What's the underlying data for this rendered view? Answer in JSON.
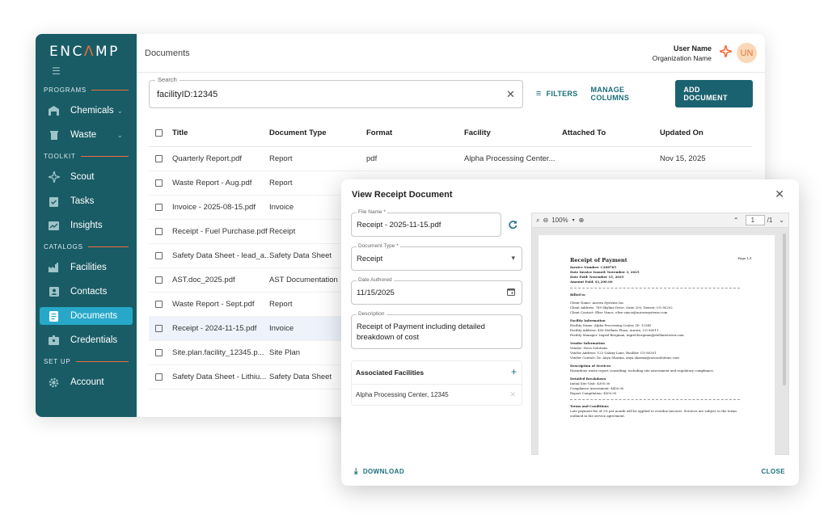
{
  "app": {
    "logo": "ENC",
    "logo_caret": "Λ",
    "logo_rest": "MP",
    "breadcrumb": "Documents",
    "user": {
      "name": "User Name",
      "org": "Organization Name",
      "initials": "UN"
    }
  },
  "sidebar": {
    "sections": {
      "programs": "PROGRAMS",
      "toolkit": "TOOLKIT",
      "catalogs": "CATALOGS",
      "setup": "SET UP"
    },
    "items": {
      "chemicals": "Chemicals",
      "waste": "Waste",
      "scout": "Scout",
      "tasks": "Tasks",
      "insights": "Insights",
      "facilities": "Facilities",
      "contacts": "Contacts",
      "documents": "Documents",
      "credentials": "Credentials",
      "account": "Account"
    },
    "active": "documents"
  },
  "toolbar": {
    "search_label": "Search",
    "search_value": "facilityID:12345",
    "filters": "FILTERS",
    "manage_columns": "MANAGE COLUMNS",
    "add_document": "ADD DOCUMENT"
  },
  "table": {
    "headers": {
      "title": "Title",
      "type": "Document Type",
      "format": "Format",
      "facility": "Facility",
      "attached": "Attached To",
      "updated": "Updated On"
    },
    "rows": [
      {
        "title": "Quarterly Report.pdf",
        "type": "Report",
        "format": "pdf",
        "facility": "Alpha Processing Center...",
        "attached": "",
        "updated": "Nov 15, 2025"
      },
      {
        "title": "Waste Report - Aug.pdf",
        "type": "Report",
        "format": "",
        "facility": "",
        "attached": "",
        "updated": ""
      },
      {
        "title": "Invoice - 2025-08-15.pdf",
        "type": "Invoice",
        "format": "",
        "facility": "",
        "attached": "",
        "updated": ""
      },
      {
        "title": "Receipt - Fuel Purchase.pdf",
        "type": "Receipt",
        "format": "",
        "facility": "",
        "attached": "",
        "updated": ""
      },
      {
        "title": "Safety Data Sheet - lead_a...",
        "type": "Safety Data Sheet",
        "format": "",
        "facility": "",
        "attached": "",
        "updated": ""
      },
      {
        "title": "AST.doc_2025.pdf",
        "type": "AST Documentation",
        "format": "",
        "facility": "",
        "attached": "",
        "updated": ""
      },
      {
        "title": "Waste Report - Sept.pdf",
        "type": "Report",
        "format": "",
        "facility": "",
        "attached": "",
        "updated": ""
      },
      {
        "title": "Receipt - 2024-11-15.pdf",
        "type": "Invoice",
        "format": "",
        "facility": "",
        "attached": "",
        "updated": ""
      },
      {
        "title": "Site.plan.facility_12345.p...",
        "type": "Site Plan",
        "format": "",
        "facility": "",
        "attached": "",
        "updated": ""
      },
      {
        "title": "Safety Data Sheet - Lithiu...",
        "type": "Safety Data Sheet",
        "format": "",
        "facility": "",
        "attached": "",
        "updated": ""
      }
    ]
  },
  "modal": {
    "title": "View Receipt Document",
    "file_name_label": "File Name *",
    "file_name": "Receipt - 2025-11-15.pdf",
    "doc_type_label": "Document Type *",
    "doc_type": "Receipt",
    "date_label": "Date Authored",
    "date": "11/15/2025",
    "desc_label": "Description",
    "desc_line1": "Receipt of Payment including detailed",
    "desc_line2": "breakdown of cost",
    "assoc_header": "Associated Facilities",
    "assoc_item": "Alpha Processing Center, 12345",
    "download": "DOWNLOAD",
    "close": "CLOSE"
  },
  "viewer": {
    "zoom": "100%",
    "page_input": "1",
    "page_total": "/1",
    "doc": {
      "page_label": "Page 1/1",
      "title": "Receipt of Payment",
      "meta": [
        "Invoice Number: C208765",
        "Date Invoice Issued: November 3, 2025",
        "Date Paid: November 15, 2025",
        "Amount Paid: $1,200.00"
      ],
      "billed_to": "Billed to",
      "client": [
        "Client Name: Aurora Systems Inc.",
        "Client Address: 789 Skyline Drive, Suite 200, Denver, CO 80202",
        "Client Contact: Elise Vance, elise.vance@aurorasystems.com"
      ],
      "facility_h": "Facility Information",
      "facility": [
        "Facility Name: Alpha Processing Center, ID: 12345",
        "Facility Address: 456 Stellaris Plaza, Aurora, CO 80011",
        "Facility Manager: Ingrid Bergman, ingrid.bergman@stellaristower.com"
      ],
      "vendor_h": "Vendor Information",
      "vendor": [
        "Vendor: Nova Solutions",
        "Vendor Address: 123 Galaxy Lane, Boulder, CO 80301",
        "Vendor Contact: Dr. Anya Sharma, anya.sharma@novasolutions.com"
      ],
      "services_h": "Description of Services",
      "services": "Hazardous waste report consulting, including site assessment and regulatory compliance.",
      "breakdown_h": "Detailed Breakdown",
      "breakdown": [
        "Initial Site Visit: $300.00",
        "Compliance Assessment: $450.00",
        "Report Compilation: $500.00"
      ],
      "terms_h": "Terms and Conditions",
      "terms": [
        "Late payment fee of 2% per month will be applied to overdue invoices. Services are subject to the terms",
        "outlined in the service agreement."
      ]
    }
  },
  "colors": {
    "sidebar": "#195c66",
    "accent": "#f26b3a",
    "active_nav": "#27a8c8",
    "primary": "#1b6270"
  }
}
